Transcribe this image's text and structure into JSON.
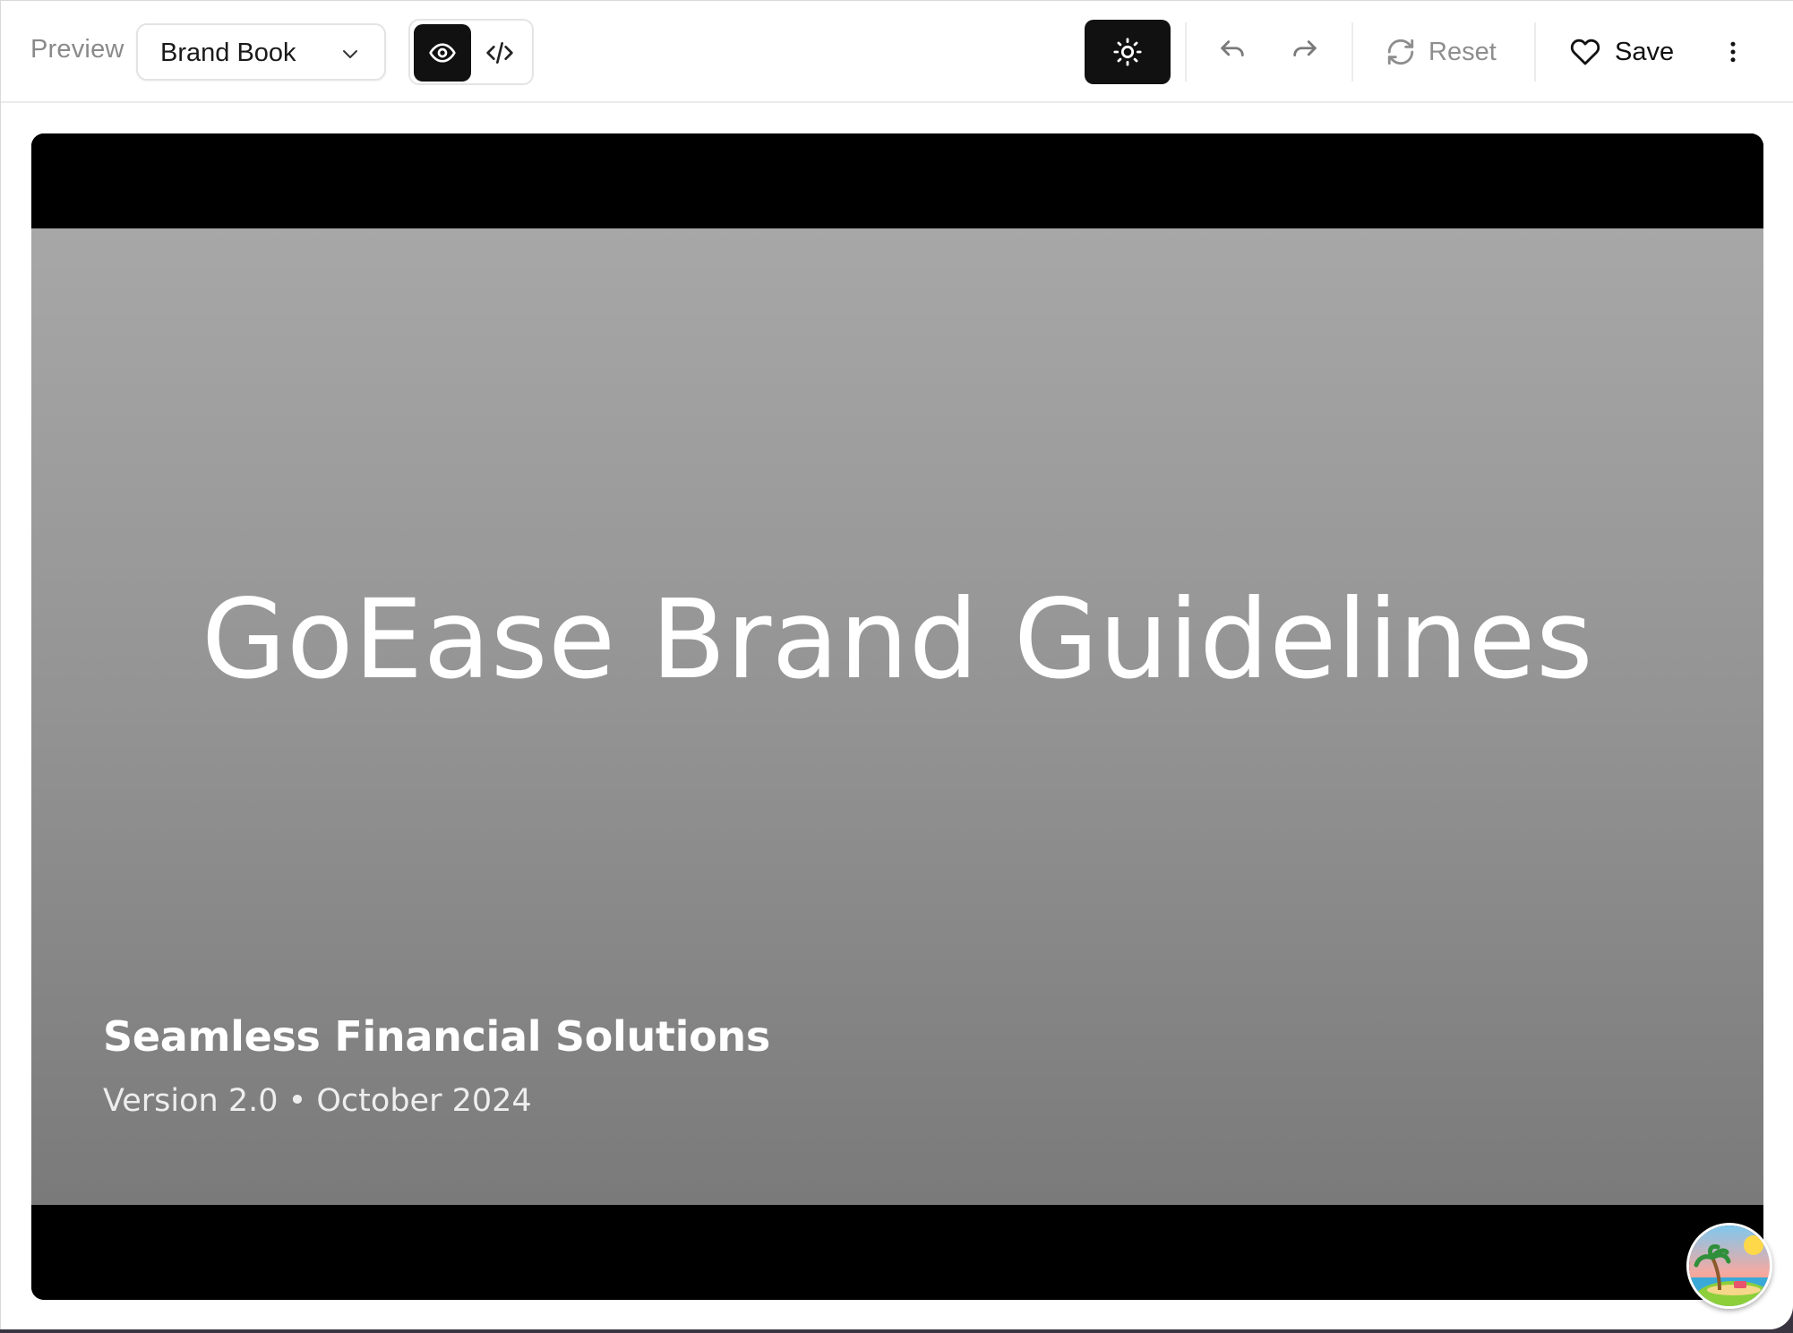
{
  "toolbar": {
    "preview_label": "Preview",
    "document_select": {
      "value": "Brand Book"
    },
    "view_modes": {
      "preview": "eye-icon",
      "code": "code-icon",
      "active": "preview"
    },
    "theme_icon": "sun-icon",
    "undo_icon": "undo-icon",
    "redo_icon": "redo-icon",
    "reset_label": "Reset",
    "save_label": "Save",
    "more_icon": "vertical-dots-icon"
  },
  "slide": {
    "title": "GoEase Brand Guidelines",
    "subtitle": "Seamless Financial Solutions",
    "meta": "Version 2.0 • October 2024"
  },
  "colors": {
    "accent_dark": "#111111",
    "muted_text": "#8a8a8a",
    "slide_gradient_top": "#a7a7a7",
    "slide_gradient_bottom": "#7a7a7a"
  }
}
